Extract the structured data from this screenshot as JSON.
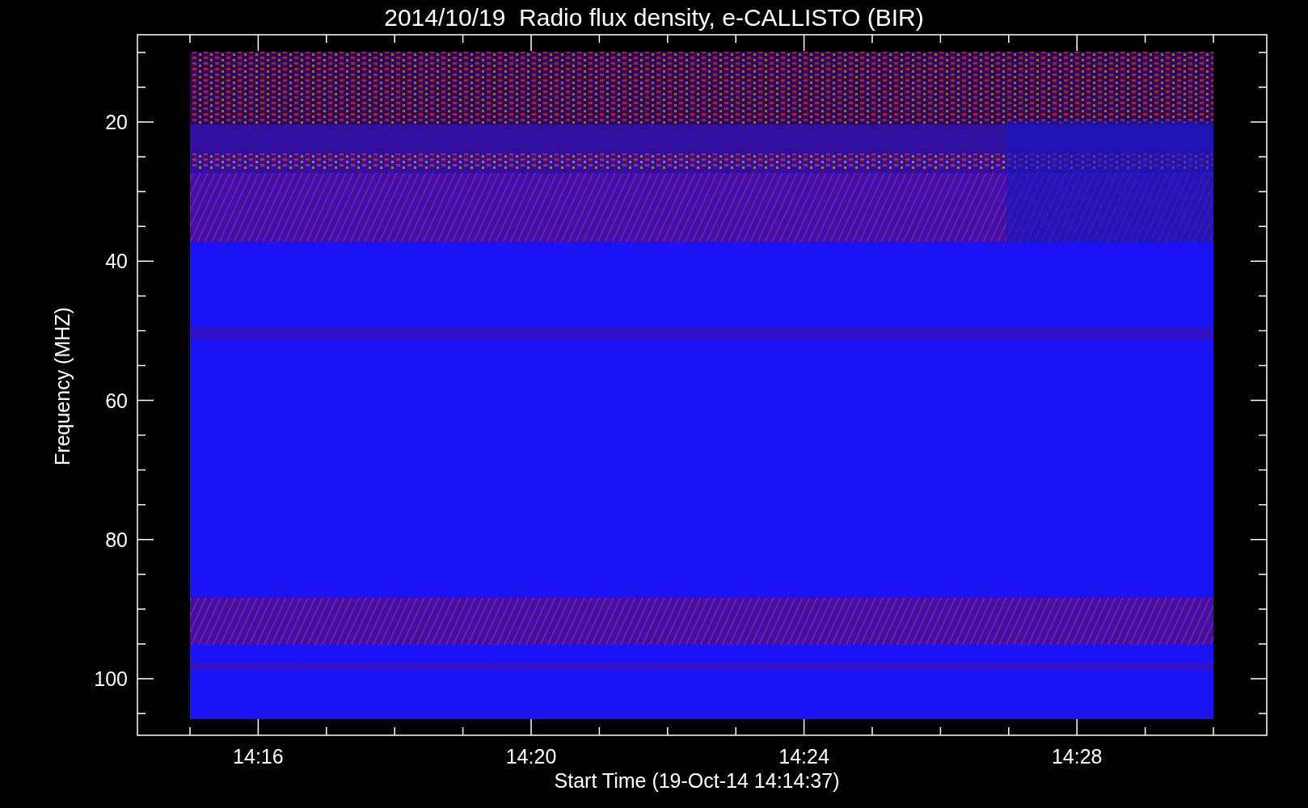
{
  "title": "2014/10/19  Radio flux density, e-CALLISTO (BIR)",
  "y_axis": {
    "label": "Frequency (MHZ)",
    "ticks": [
      "20",
      "40",
      "60",
      "80",
      "100"
    ]
  },
  "x_axis": {
    "label": "Start Time (19-Oct-14 14:14:37)",
    "ticks": [
      "14:16",
      "14:20",
      "14:24",
      "14:28"
    ]
  }
}
